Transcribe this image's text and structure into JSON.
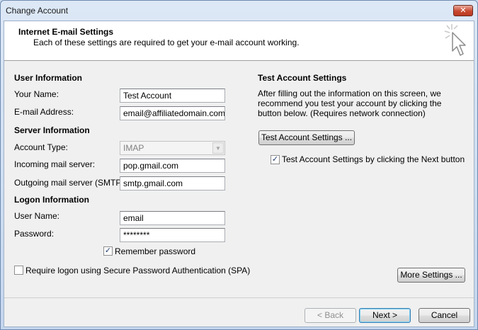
{
  "window": {
    "title": "Change Account",
    "close_label": "✕"
  },
  "header": {
    "title": "Internet E-mail Settings",
    "subtitle": "Each of these settings are required to get your e-mail account working."
  },
  "user_info": {
    "heading": "User Information",
    "name_label": "Your Name:",
    "name_value": "Test Account",
    "email_label": "E-mail Address:",
    "email_value": "email@affiliatedomain.com"
  },
  "server_info": {
    "heading": "Server Information",
    "account_type_label": "Account Type:",
    "account_type_value": "IMAP",
    "incoming_label": "Incoming mail server:",
    "incoming_value": "pop.gmail.com",
    "outgoing_label": "Outgoing mail server (SMTP):",
    "outgoing_value": "smtp.gmail.com"
  },
  "logon_info": {
    "heading": "Logon Information",
    "username_label": "User Name:",
    "username_value": "email",
    "password_label": "Password:",
    "password_value": "********",
    "remember_label": "Remember password",
    "remember_checked": true,
    "spa_label": "Require logon using Secure Password Authentication (SPA)",
    "spa_checked": false
  },
  "test_settings": {
    "heading": "Test Account Settings",
    "description": "After filling out the information on this screen, we recommend you test your account by clicking the button below. (Requires network connection)",
    "button_label": "Test Account Settings ...",
    "next_check_label": "Test Account Settings by clicking the Next button",
    "next_check_checked": true
  },
  "buttons": {
    "more_settings": "More Settings ...",
    "back": "< Back",
    "next": "Next >",
    "cancel": "Cancel"
  },
  "icons": {
    "checkmark": "✓",
    "dropdown": "▼"
  }
}
